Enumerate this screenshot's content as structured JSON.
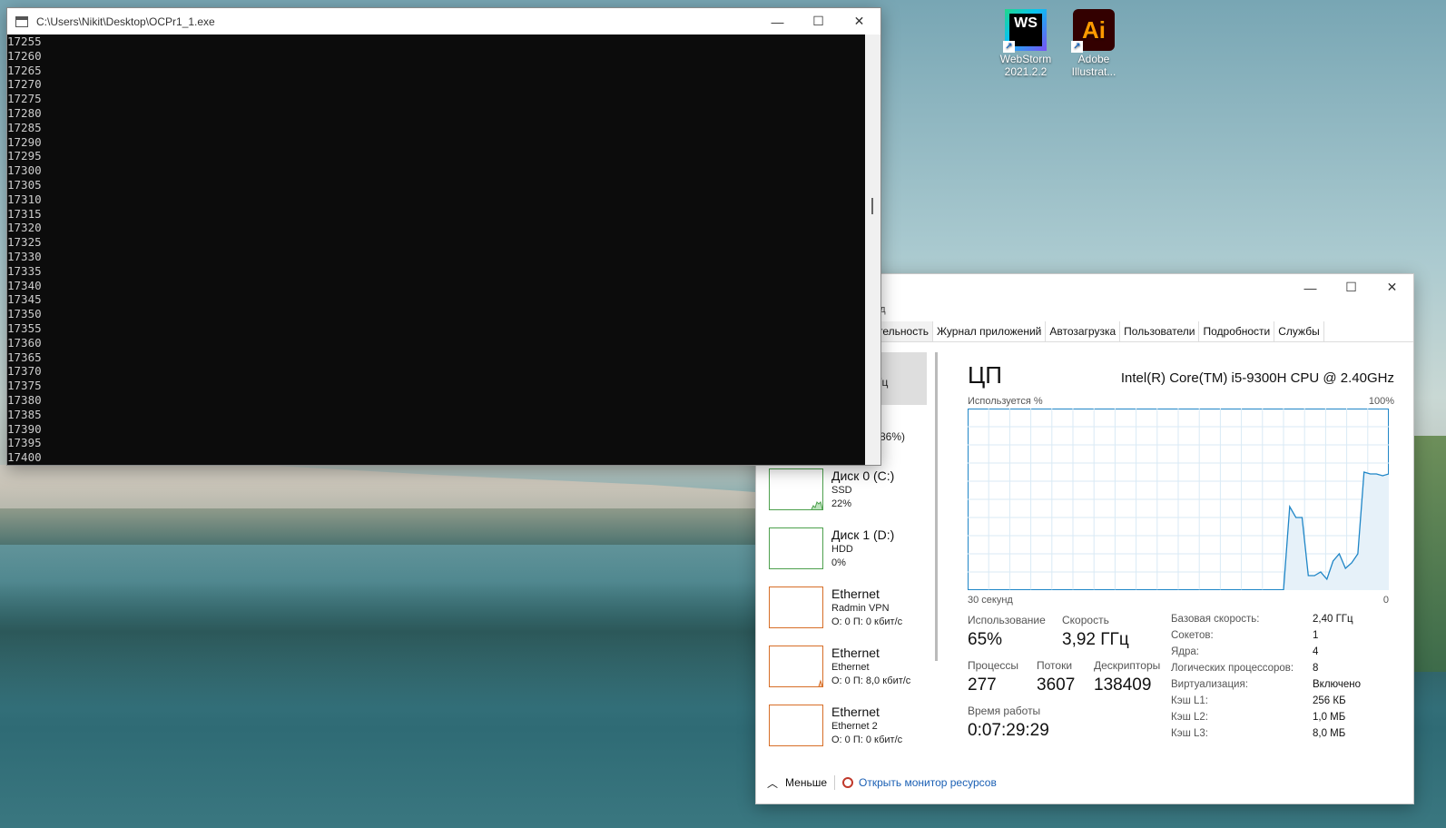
{
  "desktop": {
    "icons": [
      {
        "label": "WebStorm 2021.2.2",
        "glyph": "WS",
        "icon": "webstorm-icon"
      },
      {
        "label": "Adobe Illustrat...",
        "glyph": "Ai",
        "icon": "illustrator-icon"
      }
    ]
  },
  "console": {
    "title": "C:\\Users\\Nikit\\Desktop\\OCPr1_1.exe",
    "lines": [
      "17255",
      "17260",
      "17265",
      "17270",
      "17275",
      "17280",
      "17285",
      "17290",
      "17295",
      "17300",
      "17305",
      "17310",
      "17315",
      "17320",
      "17325",
      "17330",
      "17335",
      "17340",
      "17345",
      "17350",
      "17355",
      "17360",
      "17365",
      "17370",
      "17375",
      "17380",
      "17385",
      "17390",
      "17395",
      "17400"
    ]
  },
  "window_controls": {
    "minimize": "—",
    "maximize": "☐",
    "close": "✕"
  },
  "taskmgr": {
    "menu_fragment": "ид",
    "tabs": [
      "тельность",
      "Журнал приложений",
      "Автозагрузка",
      "Пользователи",
      "Подробности",
      "Службы"
    ],
    "selected_fragment": "Гц",
    "memory_fragment": "(86%)",
    "resources": [
      {
        "name": "Диск 0 (C:)",
        "sub": "SSD",
        "val": "22%"
      },
      {
        "name": "Диск 1 (D:)",
        "sub": "HDD",
        "val": "0%"
      },
      {
        "name": "Ethernet",
        "sub": "Radmin VPN",
        "val": "О: 0 П: 0 кбит/с"
      },
      {
        "name": "Ethernet",
        "sub": "Ethernet",
        "val": "О: 0 П: 8,0 кбит/с"
      },
      {
        "name": "Ethernet",
        "sub": "Ethernet 2",
        "val": "О: 0 П: 0 кбит/с"
      }
    ],
    "cpu": {
      "heading": "ЦП",
      "model": "Intel(R) Core(TM) i5-9300H CPU @ 2.40GHz",
      "usage_label": "Используется %",
      "max_label": "100%",
      "time_label": "30 секунд",
      "zero_label": "0",
      "utilization_label": "Использование",
      "utilization": "65%",
      "speed_label": "Скорость",
      "speed": "3,92 ГГц",
      "processes_label": "Процессы",
      "processes": "277",
      "threads_label": "Потоки",
      "threads": "3607",
      "handles_label": "Дескрипторы",
      "handles": "138409",
      "uptime_label": "Время работы",
      "uptime": "0:07:29:29",
      "details": [
        {
          "k": "Базовая скорость:",
          "v": "2,40 ГГц"
        },
        {
          "k": "Сокетов:",
          "v": "1"
        },
        {
          "k": "Ядра:",
          "v": "4"
        },
        {
          "k": "Логических процессоров:",
          "v": "8"
        },
        {
          "k": "Виртуализация:",
          "v": "Включено"
        },
        {
          "k": "Кэш L1:",
          "v": "256 КБ"
        },
        {
          "k": "Кэш L2:",
          "v": "1,0 МБ"
        },
        {
          "k": "Кэш L3:",
          "v": "8,0 МБ"
        }
      ],
      "graph_series_percent": [
        0,
        0,
        0,
        0,
        0,
        0,
        0,
        0,
        0,
        0,
        0,
        0,
        0,
        0,
        0,
        0,
        0,
        0,
        0,
        0,
        0,
        0,
        0,
        0,
        0,
        0,
        0,
        0,
        0,
        0,
        0,
        0,
        0,
        0,
        0,
        0,
        0,
        0,
        0,
        0,
        0,
        0,
        0,
        0,
        0,
        0,
        0,
        0,
        0,
        0,
        0,
        0,
        46,
        40,
        40,
        8,
        8,
        10,
        6,
        16,
        20,
        12,
        15,
        20,
        65,
        64,
        64,
        63,
        64
      ],
      "graph_color": "#1f86c7"
    },
    "footer": {
      "less": "Меньше",
      "resource_monitor": "Открыть монитор ресурсов"
    }
  }
}
